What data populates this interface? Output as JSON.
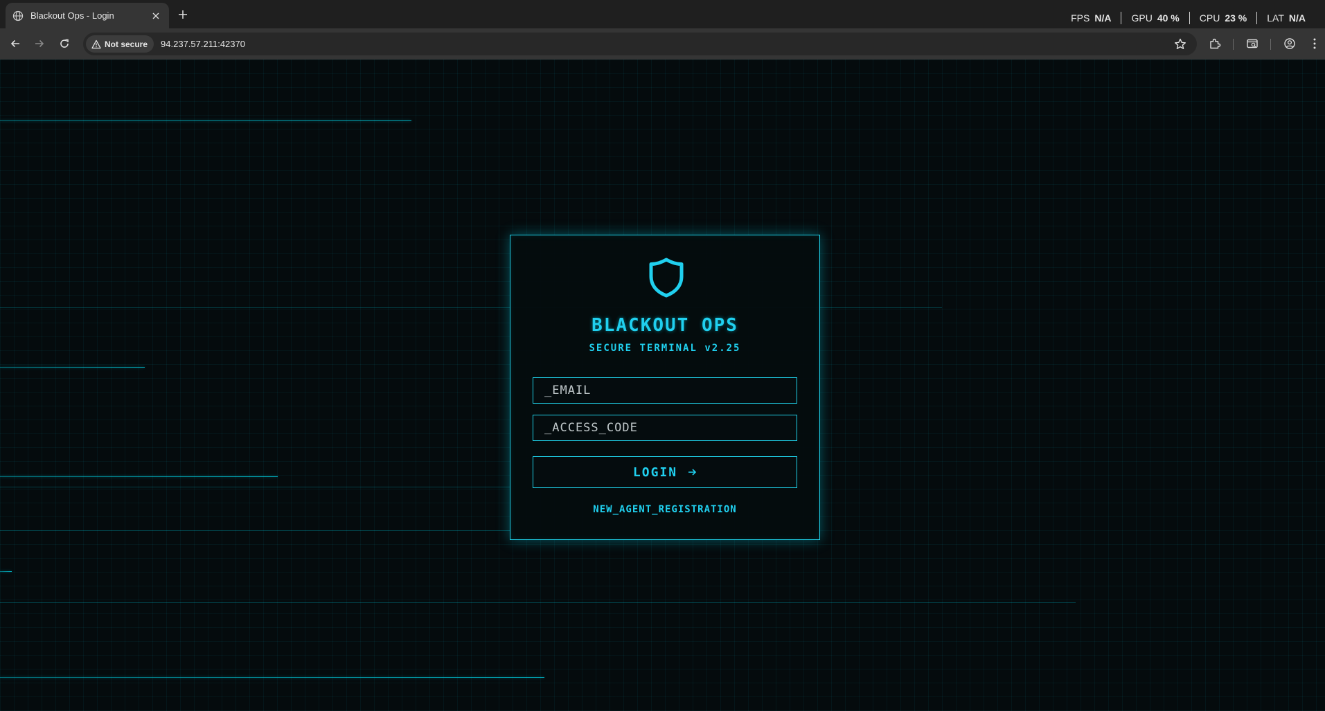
{
  "browser": {
    "tab": {
      "title": "Blackout Ops - Login",
      "favicon": "globe-icon"
    },
    "perf": [
      {
        "label": "FPS",
        "value": "N/A"
      },
      {
        "label": "GPU",
        "value": "40 %"
      },
      {
        "label": "CPU",
        "value": "23 %"
      },
      {
        "label": "LAT",
        "value": "N/A"
      }
    ],
    "security_label": "Not secure",
    "url": "94.237.57.211:42370"
  },
  "login": {
    "logo": "shield-icon",
    "title": "BLACKOUT OPS",
    "subtitle": "SECURE TERMINAL v2.25",
    "email_placeholder": "_EMAIL",
    "email_value": "",
    "code_placeholder": "_ACCESS_CODE",
    "code_value": "",
    "login_label": "LOGIN",
    "register_link": "NEW_AGENT_REGISTRATION"
  },
  "colors": {
    "accent": "#20d0ef",
    "background": "#050b0d",
    "chrome_dark": "#1f1f1f",
    "chrome": "#353535"
  }
}
